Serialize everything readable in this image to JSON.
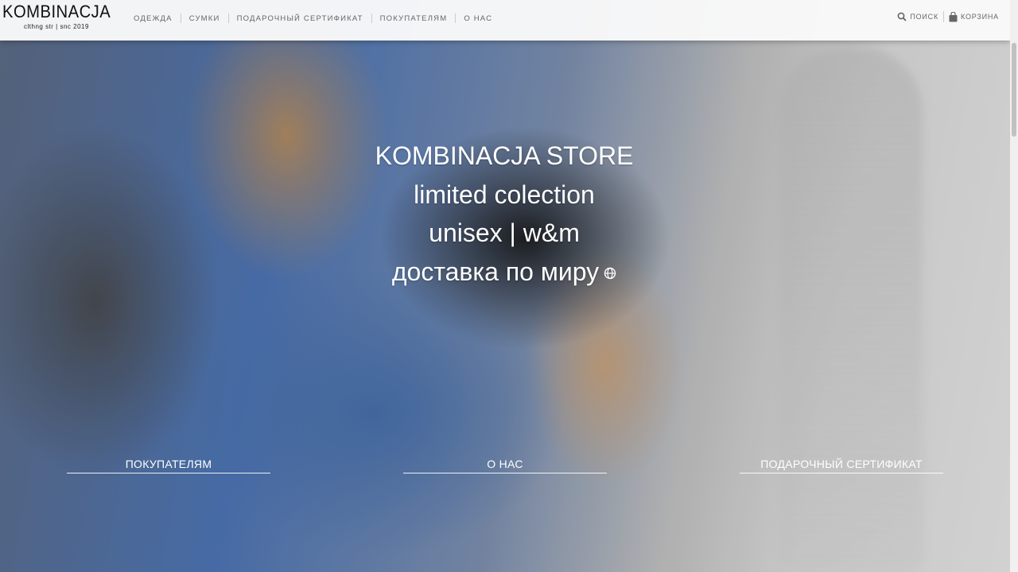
{
  "logo": {
    "title": "KOMBINACJA",
    "subtitle": "clthng str | snc 2019"
  },
  "nav": {
    "items": [
      {
        "label": "ОДЕЖДА"
      },
      {
        "label": "СУМКИ"
      },
      {
        "label": "ПОДАРОЧНЫЙ СЕРТИФИКАТ"
      },
      {
        "label": "ПОКУПАТЕЛЯМ"
      },
      {
        "label": "О НАС"
      }
    ]
  },
  "tools": {
    "search_label": "ПОИСК",
    "cart_label": "КОРЗИНА"
  },
  "hero": {
    "lines": [
      "KOMBINACJA STORE",
      "limited colection",
      "unisex | w&m",
      "доставка по миру"
    ],
    "icons": {
      "globe": "globe-icon"
    }
  },
  "links": [
    {
      "label": "ПОКУПАТЕЛЯМ"
    },
    {
      "label": "О НАС"
    },
    {
      "label": "ПОДАРОЧНЫЙ СЕРТИФИКАТ"
    }
  ],
  "colors": {
    "header_bg": "#fafafa",
    "nav_text": "#666666",
    "hero_text": "#ffffff"
  }
}
